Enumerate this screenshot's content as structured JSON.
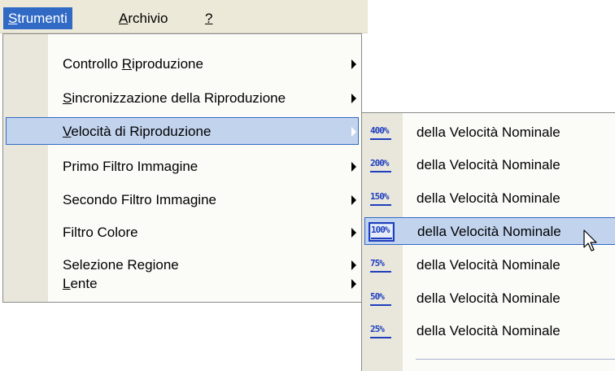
{
  "menubar": {
    "items": [
      {
        "first": "S",
        "rest": "trumenti"
      },
      {
        "first": "A",
        "rest": "rchivio"
      },
      {
        "first": "?",
        "rest": ""
      }
    ]
  },
  "menu": {
    "items": [
      {
        "pre": "Controllo ",
        "acc": "R",
        "post": "iproduzione"
      },
      {
        "pre": "",
        "acc": "S",
        "post": "incronizzazione della Riproduzione"
      },
      {
        "pre": "",
        "acc": "V",
        "post": "elocità di Riproduzione"
      },
      {
        "pre": "Primo Filtro Immagine",
        "acc": "",
        "post": ""
      },
      {
        "pre": "Secondo Filtro Immagine",
        "acc": "",
        "post": ""
      },
      {
        "pre": "Filtro Colore",
        "acc": "",
        "post": ""
      },
      {
        "pre": "Selezione Re",
        "acc": "g",
        "post": "ione"
      },
      {
        "pre": "",
        "acc": "L",
        "post": "ente"
      }
    ]
  },
  "submenu": {
    "items": [
      {
        "icon": "400%",
        "label": "della Velocità Nominale"
      },
      {
        "icon": "200%",
        "label": "della Velocità Nominale"
      },
      {
        "icon": "150%",
        "label": "della Velocità Nominale"
      },
      {
        "icon": "100%",
        "label": "della Velocità Nominale"
      },
      {
        "icon": "75%",
        "label": "della Velocità Nominale"
      },
      {
        "icon": "50%",
        "label": "della Velocità Nominale"
      },
      {
        "icon": "25%",
        "label": "della Velocità Nominale"
      }
    ]
  },
  "colors": {
    "selection": "#316ac5",
    "highlight": "#c2d3ee",
    "menubar": "#ece9d8",
    "icon": "#1f3fbf"
  }
}
